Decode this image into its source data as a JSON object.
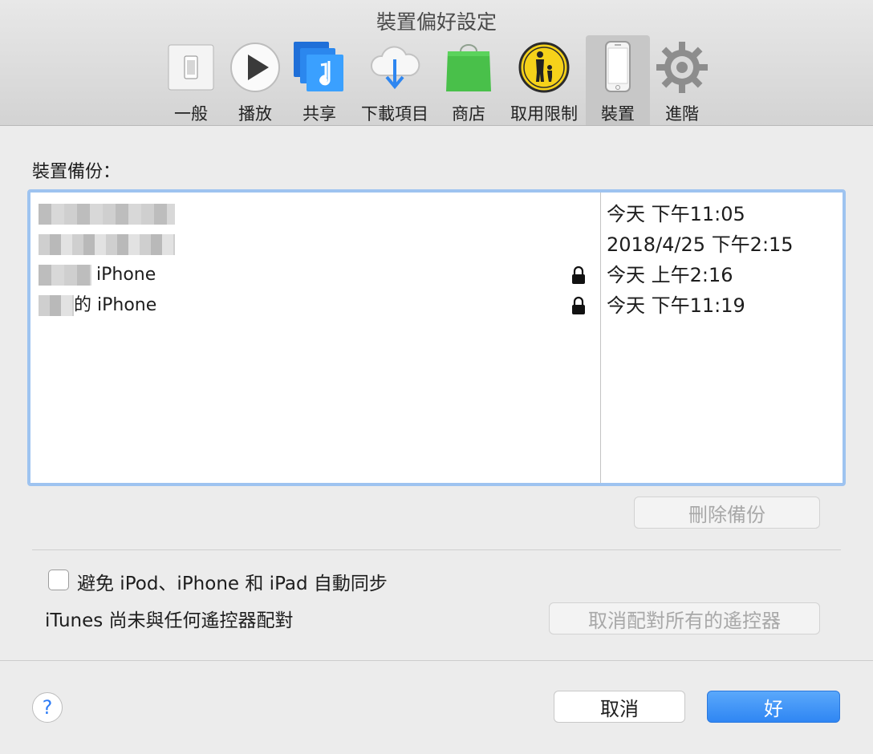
{
  "window": {
    "title": "裝置偏好設定"
  },
  "toolbar": {
    "tabs": [
      {
        "label": "一般",
        "icon": "switch-icon"
      },
      {
        "label": "播放",
        "icon": "play-icon"
      },
      {
        "label": "共享",
        "icon": "music-note-icon"
      },
      {
        "label": "下載項目",
        "icon": "cloud-download-icon"
      },
      {
        "label": "商店",
        "icon": "shopping-bag-icon"
      },
      {
        "label": "取用限制",
        "icon": "parental-controls-icon"
      },
      {
        "label": "裝置",
        "icon": "iphone-icon",
        "selected": true
      },
      {
        "label": "進階",
        "icon": "gear-icon"
      }
    ]
  },
  "backups": {
    "section_label": "裝置備份：",
    "rows": [
      {
        "name": "",
        "date": "今天 下午11:05",
        "locked": false
      },
      {
        "name": "",
        "date": "2018/4/25 下午2:15",
        "locked": false
      },
      {
        "name": "iPhone",
        "date": "今天 上午2:16",
        "locked": true
      },
      {
        "name": "的 iPhone",
        "date": "今天 下午11:19",
        "locked": true
      }
    ],
    "delete_button": "刪除備份"
  },
  "sync": {
    "prevent_sync_label": "避免 iPod、iPhone 和 iPad 自動同步",
    "prevent_sync_checked": false,
    "remote_status": "iTunes 尚未與任何遙控器配對",
    "unpair_button": "取消配對所有的遙控器"
  },
  "footer": {
    "help_label": "?",
    "cancel_button": "取消",
    "ok_button": "好"
  },
  "colors": {
    "accent": "#2f86f3",
    "selection_border": "#9ec3f0"
  }
}
